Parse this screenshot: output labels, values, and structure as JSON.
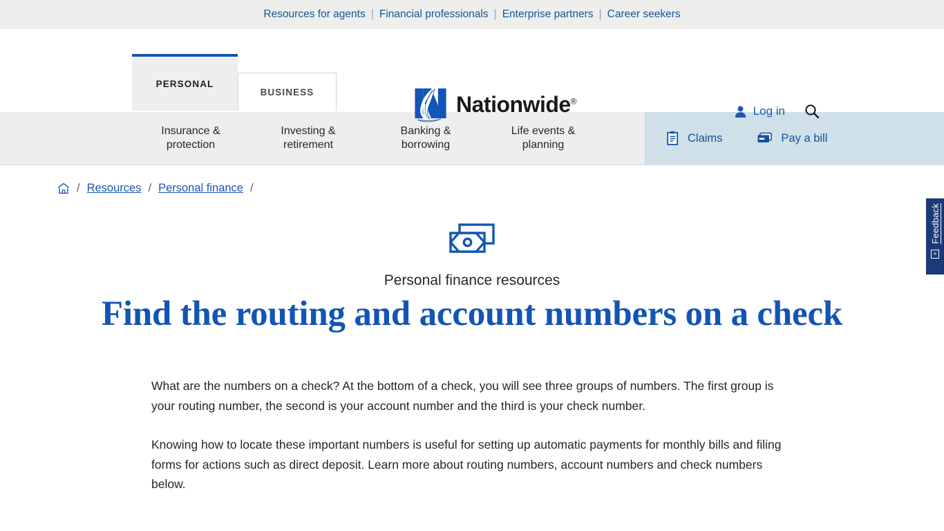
{
  "utility": {
    "links": [
      {
        "label": "Resources for agents"
      },
      {
        "label": "Financial professionals"
      },
      {
        "label": "Enterprise partners"
      },
      {
        "label": "Career seekers"
      }
    ],
    "separator": "|"
  },
  "header": {
    "tabs": [
      {
        "label": "PERSONAL",
        "active": true
      },
      {
        "label": "BUSINESS",
        "active": false
      }
    ],
    "logo_text": "Nationwide",
    "logo_registered": "®",
    "login_label": "Log in",
    "search_icon": "search-icon",
    "user_icon": "user-icon"
  },
  "mainnav": {
    "items": [
      {
        "line1": "Insurance &",
        "line2": "protection"
      },
      {
        "line1": "Investing &",
        "line2": "retirement"
      },
      {
        "line1": "Banking &",
        "line2": "borrowing"
      },
      {
        "line1": "Life events &",
        "line2": "planning"
      }
    ],
    "actions": [
      {
        "label": "Claims",
        "icon": "clipboard-icon"
      },
      {
        "label": "Pay a bill",
        "icon": "money-card-icon"
      }
    ]
  },
  "breadcrumb": {
    "home_icon": "home-icon",
    "items": [
      {
        "label": "Resources"
      },
      {
        "label": "Personal finance"
      }
    ],
    "separator": "/"
  },
  "hero": {
    "icon": "banknote-icon",
    "eyebrow": "Personal finance resources",
    "title": "Find the routing and account numbers on a check"
  },
  "article": {
    "paragraphs": [
      "What are the numbers on a check? At the bottom of a check, you will see three groups of numbers. The first group is your routing number, the second is your account number and the third is your check number.",
      "Knowing how to locate these important numbers is useful for setting up automatic payments for monthly bills and filing forms for actions such as direct deposit. Learn more about routing numbers, account numbers and check numbers below."
    ]
  },
  "feedback": {
    "label": "Feedback",
    "expand_symbol": "+"
  },
  "colors": {
    "brand_blue": "#1355b4",
    "link_blue": "#1c56b5",
    "nav_grey": "#efeeec",
    "nav_blue_panel": "#cfe0e8",
    "feedback_navy": "#1b3a7a",
    "text_dark": "#26262a"
  }
}
